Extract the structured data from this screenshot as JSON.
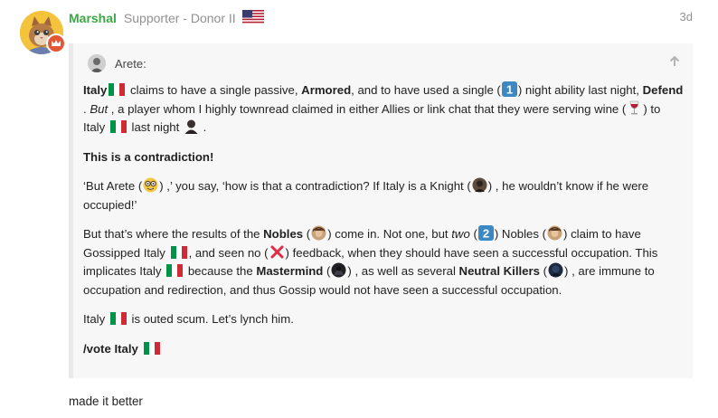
{
  "post": {
    "username": "Marshal",
    "user_title": "Supporter - Donor II",
    "date": "3d",
    "avatar_icon": "cat-avatar-icon",
    "badge_icon": "crown-icon",
    "flag_icon": "us-flag-icon",
    "reply_text": "made it better"
  },
  "quote": {
    "username": "Arete:",
    "collapse_icon": "arrow-up-icon",
    "p1": {
      "t1": "Italy",
      "t2": " claims to have a single passive, ",
      "t3": "Armored",
      "t4": ", and to have used a single (",
      "t5": ") night ability last night, ",
      "t6": "Defend",
      "t7": " . ",
      "t8": "But",
      "t9": " , a player whom I highly townread claimed in either Allies or link chat that they were serving wine (",
      "t10": ") to Italy ",
      "t11": " last night ",
      "t12": " ."
    },
    "p2": "This is a contradiction!",
    "p3": {
      "t1": "‘But Arete (",
      "t2": ") ,’ you say, ‘how is that a contradiction? If Italy is a Knight (",
      "t3": ") , he wouldn’t know if he were occupied!’"
    },
    "p4": {
      "t1": "But that’s where the results of the ",
      "t2": "Nobles",
      "t3": " (",
      "t4": ") come in. Not one, but ",
      "t5": "two",
      "t6": " (",
      "t7": ") Nobles (",
      "t8": ") claim to have Gossipped Italy ",
      "t9": ", and seen no (",
      "t10": ") feedback, when they should have seen a successful occupation. This implicates Italy ",
      "t11": " because the ",
      "t12": "Mastermind",
      "t13": " (",
      "t14": ") , as well as several ",
      "t15": "Neutral Killers",
      "t16": " (",
      "t17": ") , are immune to occupation and redirection, and thus Gossip would not have seen a successful occupation."
    },
    "p5": {
      "t1": "Italy ",
      "t2": " is outed scum. Let’s lynch him."
    },
    "p6": {
      "t1": "/vote Italy"
    }
  },
  "colors": {
    "username": "#3ca845",
    "muted": "#919191",
    "quote_bg": "#f7f7f7",
    "quote_border": "#e9e9e9",
    "badge": "#e45735",
    "keycap": "#3b88c3"
  }
}
